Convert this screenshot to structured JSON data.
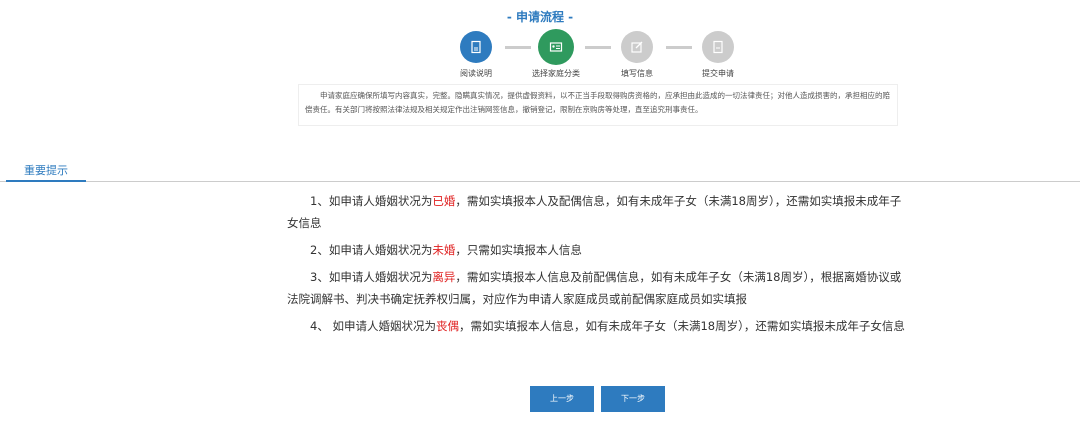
{
  "header": {
    "title": "- 申请流程 -"
  },
  "steps": [
    {
      "label": "阅读说明",
      "state": "done",
      "color": "#2e7bbf",
      "icon": "document-icon"
    },
    {
      "label": "选择家庭分类",
      "state": "current",
      "color": "#2f9a5e",
      "icon": "id-card-icon"
    },
    {
      "label": "填写信息",
      "state": "pending",
      "color": "#cccccc",
      "icon": "edit-icon"
    },
    {
      "label": "提交申请",
      "state": "pending",
      "color": "#cccccc",
      "icon": "document-icon"
    }
  ],
  "notice": "申请家庭应确保所填写内容真实，完整。隐瞒真实情况，提供虚假资料，以不正当手段取得购房资格的，应承担由此造成的一切法律责任；对他人造成损害的，承担相应的赔偿责任。有关部门将按照法律法规及相关规定作出注销网签信息，撤销登记，限制在京购房等处理，直至追究刑事责任。",
  "tab": "重要提示",
  "items": [
    {
      "pre": "1、如申请人婚姻状况为",
      "status": "已婚",
      "post": "，需如实填报本人及配偶信息，如有未成年子女（未满18周岁），还需如实填报未成年子女信息"
    },
    {
      "pre": "2、如申请人婚姻状况为",
      "status": "未婚",
      "post": "，只需如实填报本人信息"
    },
    {
      "pre": "3、如申请人婚姻状况为",
      "status": "离异",
      "post": "，需如实填报本人信息及前配偶信息，如有未成年子女（未满18周岁），根据离婚协议或法院调解书、判决书确定抚养权归属，对应作为申请人家庭成员或前配偶家庭成员如实填报"
    },
    {
      "pre": "4、 如申请人婚姻状况为",
      "status": "丧偶",
      "post": "，需如实填报本人信息，如有未成年子女（未满18周岁），还需如实填报未成年子女信息"
    }
  ],
  "buttons": {
    "prev": "上一步",
    "next": "下一步"
  }
}
